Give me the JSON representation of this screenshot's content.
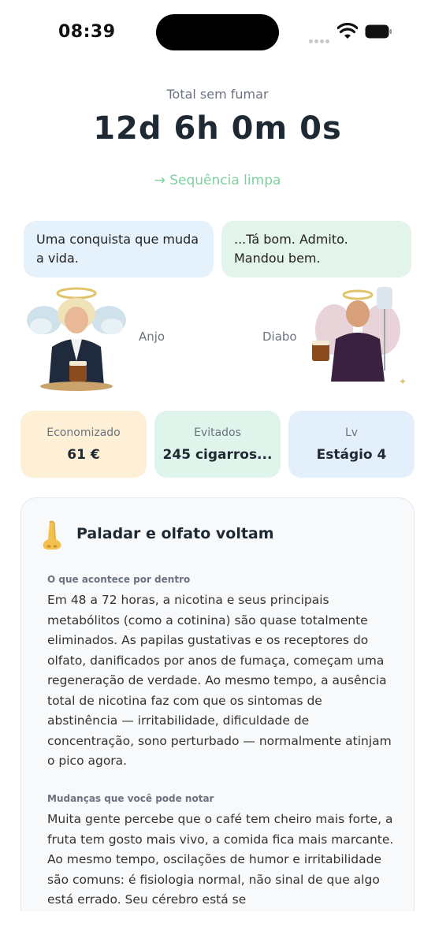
{
  "status_bar": {
    "time": "08:39"
  },
  "header": {
    "total_label": "Total sem fumar",
    "timer": "12d 6h 0m 0s",
    "streak": "→ Sequência limpa"
  },
  "bubbles": {
    "angel": "Uma conquista que muda a vida.",
    "devil": "...Tá bom. Admito. Mandou bem."
  },
  "characters": {
    "angel_label": "Anjo",
    "devil_label": "Diabo"
  },
  "stats": [
    {
      "label": "Economizado",
      "value": "61 €"
    },
    {
      "label": "Evitados",
      "value": "245 cigarros..."
    },
    {
      "label": "Lv",
      "value": "Estágio 4"
    }
  ],
  "card": {
    "icon": "nose-icon",
    "title": "Paladar e olfato voltam",
    "sections": [
      {
        "heading": "O que acontece por dentro",
        "body": "Em 48 a 72 horas, a nicotina e seus principais metabólitos (como a cotinina) são quase totalmente eliminados. As papilas gustativas e os receptores do olfato, danificados por anos de fumaça, começam uma regeneração de verdade. Ao mesmo tempo, a ausência total de nicotina faz com que os sintomas de abstinência — irritabilidade, dificuldade de concentração, sono perturbado — normalmente atinjam o pico agora."
      },
      {
        "heading": "Mudanças que você pode notar",
        "body": "Muita gente percebe que o café tem cheiro mais forte, a fruta tem gosto mais vivo, a comida fica mais marcante. Ao mesmo tempo, oscilações de humor e irritabilidade são comuns: é fisiologia normal, não sinal de que algo está errado. Seu cérebro está se"
      }
    ]
  }
}
